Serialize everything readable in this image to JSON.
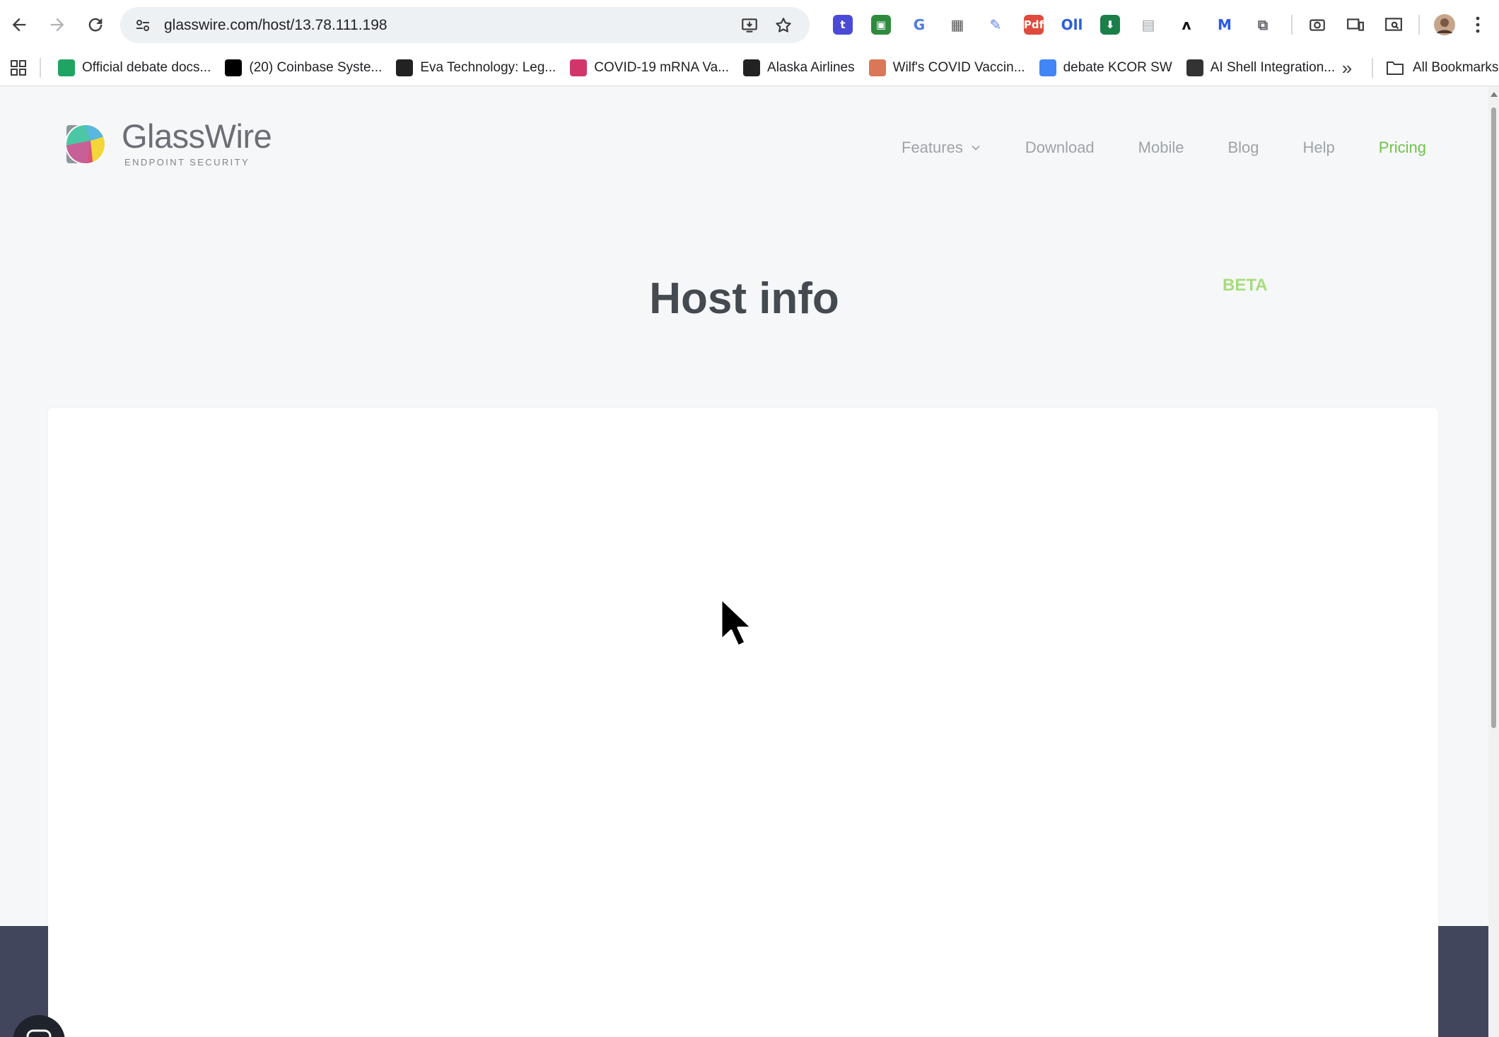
{
  "browser": {
    "url": "glasswire.com/host/13.78.111.198",
    "extensions": [
      {
        "name": "tumblr-extension-icon",
        "glyph": "t",
        "color": "#4b4ad6"
      },
      {
        "name": "robot-extension-icon",
        "glyph": "▣",
        "color": "#2e8b3d"
      },
      {
        "name": "translate-extension-icon",
        "glyph": "G",
        "color": "#4d7bd9"
      },
      {
        "name": "qr-code-extension-icon",
        "glyph": "▦",
        "color": "#555555"
      },
      {
        "name": "feather-extension-icon",
        "glyph": "✎",
        "color": "#5b7de8"
      },
      {
        "name": "pdf-extension-icon",
        "glyph": "Pdf",
        "color": "#e0493b"
      },
      {
        "name": "otter-extension-icon",
        "glyph": "Oll",
        "color": "#2a5ed6"
      },
      {
        "name": "shield-download-extension-icon",
        "glyph": "⬇",
        "color": "#1b7f4a"
      },
      {
        "name": "document-extension-icon",
        "glyph": "▤",
        "color": "#9aa0a6"
      },
      {
        "name": "anthropic-extension-icon",
        "glyph": "ʌ",
        "color": "#111111"
      },
      {
        "name": "malwarebytes-extension-icon",
        "glyph": "M",
        "color": "#2957f0"
      },
      {
        "name": "puzzle-extensions-icon",
        "glyph": "⧉",
        "color": "#5f6368"
      }
    ],
    "bookmarks": [
      {
        "label": "Official debate docs...",
        "icon": "google-drive-icon",
        "color": "#1fa463"
      },
      {
        "label": "(20) Coinbase Syste...",
        "icon": "x-icon",
        "color": "#000000"
      },
      {
        "label": "Eva Technology: Leg...",
        "icon": "eva-icon",
        "color": "#222222"
      },
      {
        "label": "COVID-19 mRNA Va...",
        "icon": "jn-icon",
        "color": "#d1366a"
      },
      {
        "label": "Alaska Airlines",
        "icon": "alaska-icon",
        "color": "#222222"
      },
      {
        "label": "Wilf's COVID Vaccin...",
        "icon": "claude-icon",
        "color": "#d97757"
      },
      {
        "label": "debate KCOR SW",
        "icon": "google-docs-icon",
        "color": "#4285f4"
      },
      {
        "label": "AI Shell Integration...",
        "icon": "cube-icon",
        "color": "#333333"
      }
    ],
    "all_bookmarks_label": "All Bookmarks"
  },
  "site": {
    "logo_name": "GlassWire",
    "logo_sub": "ENDPOINT SECURITY",
    "nav": [
      "Features",
      "Download",
      "Mobile",
      "Blog",
      "Help",
      "Pricing"
    ],
    "active_nav": "Pricing",
    "accent": "#70c24a",
    "title": "Host info",
    "badge": "BETA"
  }
}
